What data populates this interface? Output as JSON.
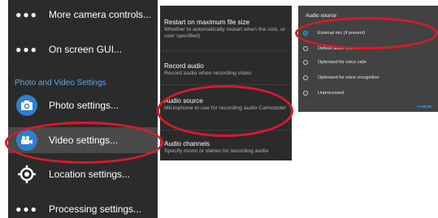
{
  "left": {
    "items": [
      {
        "label": "More camera controls...",
        "icon": "dots-icon"
      },
      {
        "label": "On screen GUI...",
        "icon": "dots-icon"
      }
    ],
    "section_header": "Photo and Video Settings",
    "settings": [
      {
        "label": "Photo settings...",
        "icon": "camera-icon"
      },
      {
        "label": "Video settings...",
        "icon": "video-camera-icon"
      },
      {
        "label": "Location settings...",
        "icon": "location-icon"
      },
      {
        "label": "Processing settings...",
        "icon": "dots-icon"
      }
    ]
  },
  "mid": {
    "items": [
      {
        "title": "Restart on maximum file size",
        "sub": "Whether to automatically restart when the size, or user specified)"
      },
      {
        "title": "Record audio",
        "sub": "Record audio when recording video"
      },
      {
        "title": "Audio source",
        "sub": "Microphone to use for recording audio Camcorder"
      },
      {
        "title": "Audio channels",
        "sub": "Specify mono or stereo for recording audio"
      }
    ]
  },
  "dialog": {
    "title": "Audio source",
    "options": [
      {
        "label": "External mic (if present)",
        "selected": true
      },
      {
        "label": "Default audio source",
        "selected": false
      },
      {
        "label": "Optimised for voice calls",
        "selected": false
      },
      {
        "label": "Optimised for voice recognition",
        "selected": false
      },
      {
        "label": "Unprocessed",
        "selected": false
      }
    ],
    "cancel": "CANCEL"
  },
  "colors": {
    "accent": "#2f7fd0",
    "section_header": "#5aa8e6",
    "annotation": "#d81b28",
    "panel_bg": "#2b2b2b",
    "dialog_bg": "#424242"
  }
}
